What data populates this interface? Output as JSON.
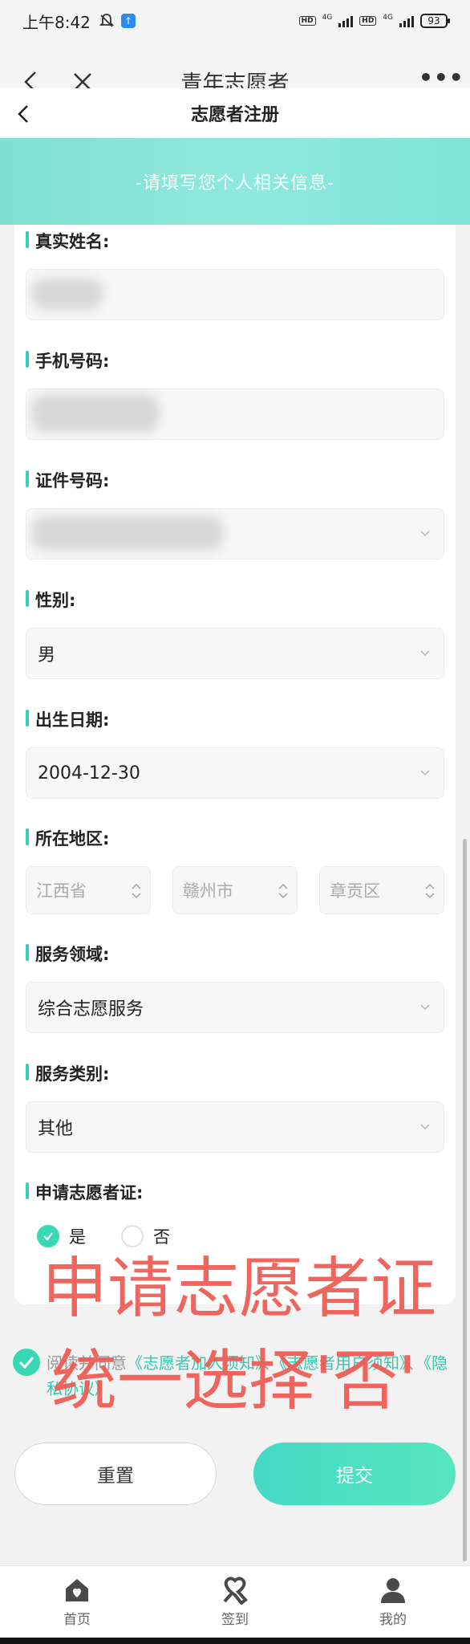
{
  "status_bar": {
    "time": "上午8:42",
    "network_labels": [
      "HD",
      "4G",
      "HD",
      "4G"
    ],
    "battery": "93"
  },
  "browser": {
    "title": "青年志愿者",
    "more_label": "•••"
  },
  "page": {
    "title": "志愿者注册",
    "banner": "-请填写您个人相关信息-"
  },
  "form": {
    "name_label": "真实姓名:",
    "phone_label": "手机号码:",
    "id_label": "证件号码:",
    "gender_label": "性别:",
    "gender_value": "男",
    "birth_label": "出生日期:",
    "birth_value": "2004-12-30",
    "region_label": "所在地区:",
    "region": {
      "province": "江西省",
      "city": "赣州市",
      "district": "章贡区"
    },
    "service_field_label": "服务领域:",
    "service_field_value": "综合志愿服务",
    "service_type_label": "服务类别:",
    "service_type_value": "其他",
    "certificate_label": "申请志愿者证:",
    "certificate_options": [
      {
        "label": "是",
        "selected": true
      },
      {
        "label": "否",
        "selected": false
      }
    ]
  },
  "agreement": {
    "prefix": "阅读并同意",
    "link1": "《志愿者加入须知》",
    "sep1": "、",
    "link2": "《志愿者用户须知》",
    "sep2": "、",
    "link3": "《隐私协议》"
  },
  "buttons": {
    "reset": "重置",
    "submit": "提交"
  },
  "overlay": {
    "line1": "申请志愿者证",
    "line2": "统一选择'否'"
  },
  "tabbar": {
    "items": [
      {
        "label": "首页",
        "icon": "home-heart-icon"
      },
      {
        "label": "签到",
        "icon": "ribbon-icon"
      },
      {
        "label": "我的",
        "icon": "user-icon"
      }
    ]
  },
  "colors": {
    "accent": "#38d8b5",
    "banner": "#8fe8dc",
    "overlay_text": "#ee5a52",
    "link": "#34c9b1"
  }
}
